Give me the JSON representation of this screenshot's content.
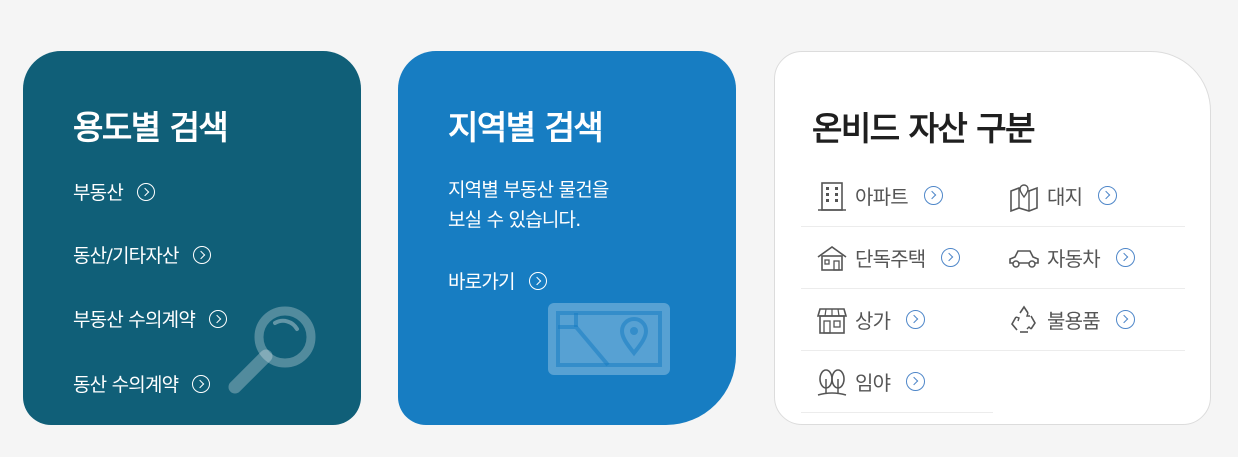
{
  "card_usage": {
    "title": "용도별 검색",
    "links": [
      {
        "label": "부동산"
      },
      {
        "label": "동산/기타자산"
      },
      {
        "label": "부동산 수의계약"
      },
      {
        "label": "동산 수의계약"
      }
    ],
    "accent": "#105f78"
  },
  "card_region": {
    "title": "지역별 검색",
    "desc_line1": "지역별 부동산 물건을",
    "desc_line2": "보실 수 있습니다.",
    "link_label": "바로가기",
    "accent": "#177dc2"
  },
  "card_assets": {
    "title": "온비드 자산 구분",
    "items": [
      {
        "label": "아파트",
        "icon": "apartment-icon"
      },
      {
        "label": "대지",
        "icon": "land-map-icon"
      },
      {
        "label": "단독주택",
        "icon": "house-icon"
      },
      {
        "label": "자동차",
        "icon": "car-icon"
      },
      {
        "label": "상가",
        "icon": "store-icon"
      },
      {
        "label": "불용품",
        "icon": "recycle-icon"
      },
      {
        "label": "임야",
        "icon": "forest-icon"
      }
    ],
    "arrow_color": "#4f87c9"
  }
}
